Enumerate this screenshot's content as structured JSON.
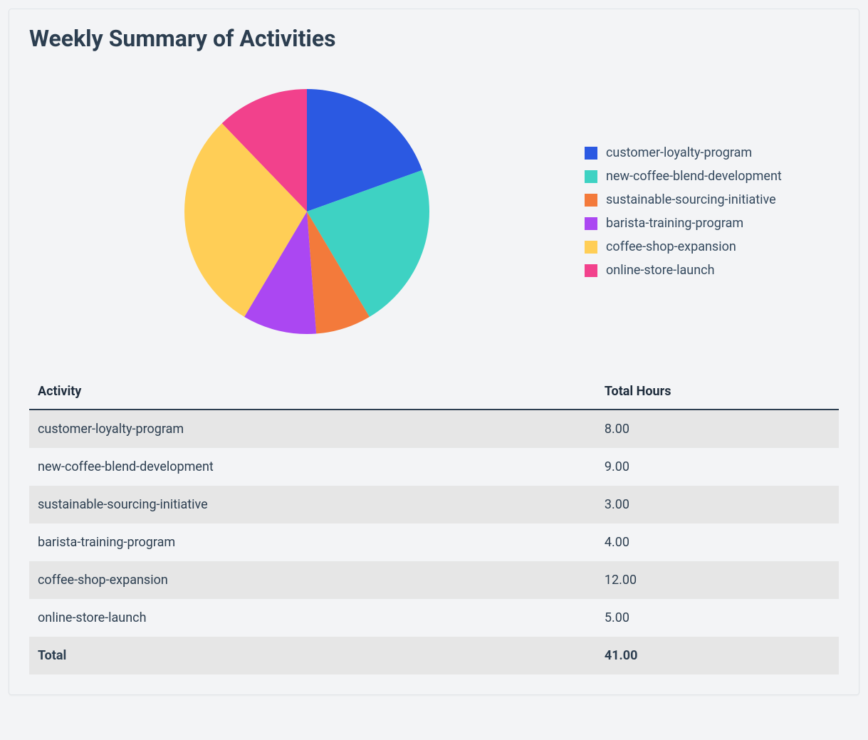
{
  "title": "Weekly Summary of Activities",
  "table": {
    "headers": {
      "activity": "Activity",
      "hours": "Total Hours"
    },
    "rows": [
      {
        "activity": "customer-loyalty-program",
        "hours": "8.00"
      },
      {
        "activity": "new-coffee-blend-development",
        "hours": "9.00"
      },
      {
        "activity": "sustainable-sourcing-initiative",
        "hours": "3.00"
      },
      {
        "activity": "barista-training-program",
        "hours": "4.00"
      },
      {
        "activity": "coffee-shop-expansion",
        "hours": "12.00"
      },
      {
        "activity": "online-store-launch",
        "hours": "5.00"
      }
    ],
    "total_label": "Total",
    "total_value": "41.00"
  },
  "legend": [
    {
      "label": "customer-loyalty-program",
      "color": "#2b59e2"
    },
    {
      "label": "new-coffee-blend-development",
      "color": "#3ed2c3"
    },
    {
      "label": "sustainable-sourcing-initiative",
      "color": "#f37a3b"
    },
    {
      "label": "barista-training-program",
      "color": "#ab47f2"
    },
    {
      "label": "coffee-shop-expansion",
      "color": "#ffce56"
    },
    {
      "label": "online-store-launch",
      "color": "#f2418c"
    }
  ],
  "chart_data": {
    "type": "pie",
    "title": "Weekly Summary of Activities",
    "categories": [
      "customer-loyalty-program",
      "new-coffee-blend-development",
      "sustainable-sourcing-initiative",
      "barista-training-program",
      "coffee-shop-expansion",
      "online-store-launch"
    ],
    "values": [
      8,
      9,
      3,
      4,
      12,
      5
    ],
    "colors": [
      "#2b59e2",
      "#3ed2c3",
      "#f37a3b",
      "#ab47f2",
      "#ffce56",
      "#f2418c"
    ]
  }
}
